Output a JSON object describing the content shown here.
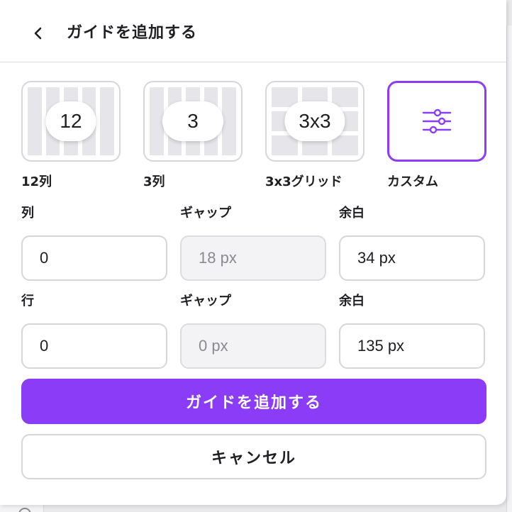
{
  "header": {
    "title": "ガイドを追加する",
    "back_icon": "chevron-left-icon"
  },
  "presets": [
    {
      "badge": "12",
      "label": "12列"
    },
    {
      "badge": "3",
      "label": "3列"
    },
    {
      "badge": "3x3",
      "label": "3x3グリッド"
    },
    {
      "icon": "sliders-icon",
      "label": "カスタム",
      "selected": true
    }
  ],
  "columns_section": {
    "count_label": "列",
    "count_value": "0",
    "gap_label": "ギャップ",
    "gap_value": "18 px",
    "margin_label": "余白",
    "margin_value": "34 px"
  },
  "rows_section": {
    "count_label": "行",
    "count_value": "0",
    "gap_label": "ギャップ",
    "gap_value": "0 px",
    "margin_label": "余白",
    "margin_value": "135 px"
  },
  "buttons": {
    "add": "ガイドを追加する",
    "cancel": "キャンセル"
  },
  "colors": {
    "accent": "#8b3cf6",
    "border": "#d6d6da",
    "disabled_bg": "#f3f3f5"
  }
}
